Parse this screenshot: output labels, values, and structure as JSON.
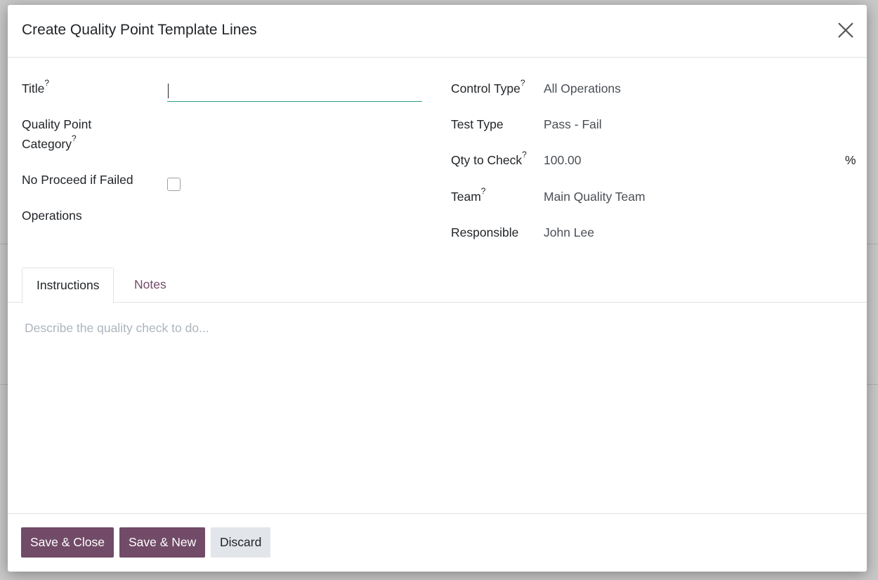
{
  "dialog": {
    "title": "Create Quality Point Template Lines",
    "close_label": "×"
  },
  "left_fields": {
    "title_label": "Title",
    "title_help": "?",
    "title_value": "",
    "category_label_1": "Quality Point",
    "category_label_2": "Category",
    "category_help": "?",
    "no_proceed_label": "No Proceed if Failed",
    "no_proceed_checked": false,
    "operations_label": "Operations"
  },
  "right_fields": {
    "control_type_label": "Control Type",
    "control_type_help": "?",
    "control_type_value": "All Operations",
    "test_type_label": "Test Type",
    "test_type_value": "Pass - Fail",
    "qty_label": "Qty to Check",
    "qty_help": "?",
    "qty_value": "100.00",
    "qty_unit": "%",
    "team_label": "Team",
    "team_help": "?",
    "team_value": "Main Quality Team",
    "responsible_label": "Responsible",
    "responsible_value": "John Lee"
  },
  "tabs": [
    {
      "label": "Instructions",
      "active": true
    },
    {
      "label": "Notes",
      "active": false
    }
  ],
  "instructions_placeholder": "Describe the quality check to do...",
  "footer": {
    "save_close": "Save & Close",
    "save_new": "Save & New",
    "discard": "Discard"
  },
  "colors": {
    "primary": "#714b67",
    "focus_underline": "#2aa18a"
  }
}
